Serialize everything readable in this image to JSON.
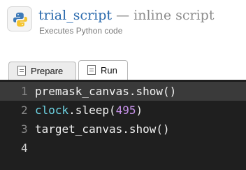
{
  "header": {
    "icon": "python-icon",
    "title_name": "trial_script",
    "title_suffix": " — inline script",
    "subtitle": "Executes Python code"
  },
  "tabs": [
    {
      "label": "Prepare",
      "icon": "document-icon",
      "active": false
    },
    {
      "label": "Run",
      "icon": "document-icon",
      "active": true
    }
  ],
  "editor": {
    "lines": [
      {
        "number": "1",
        "text": "premask_canvas.show()",
        "highlighted": true
      },
      {
        "number": "2",
        "parts": [
          "clock",
          ".sleep(",
          "495",
          ")"
        ],
        "text": "clock.sleep(495)",
        "highlighted": false
      },
      {
        "number": "3",
        "text": "target_canvas.show()",
        "highlighted": false
      },
      {
        "number": "4",
        "text": "",
        "highlighted": false,
        "current": true
      }
    ]
  },
  "colors": {
    "title_blue": "#2a6aad",
    "editor_background": "#1f1f1f",
    "line_highlight": "#3a3a3a",
    "builtin_cyan": "#6fd6e6",
    "number_purple": "#c792ea"
  }
}
